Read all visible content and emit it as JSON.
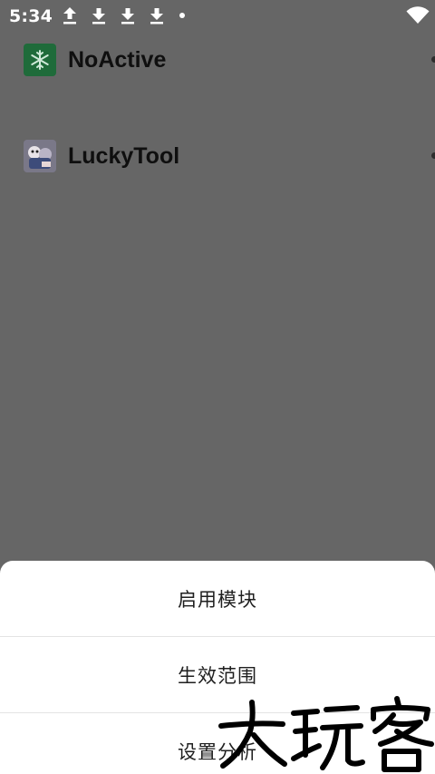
{
  "status_bar": {
    "time": "5:34",
    "icons": [
      "upload-icon",
      "download-icon",
      "download-icon",
      "download-icon",
      "notification-dot",
      "wifi-icon"
    ]
  },
  "app_list": {
    "items": [
      {
        "name": "NoActive",
        "icon": "snowflake-icon",
        "icon_color": "#1f6b3a"
      },
      {
        "name": "LuckyTool",
        "icon": "lucky-tool-icon"
      }
    ]
  },
  "bottom_sheet": {
    "items": [
      {
        "label": "启用模块"
      },
      {
        "label": "生效范围"
      },
      {
        "label": "设置分析"
      }
    ]
  },
  "watermark": {
    "text": "大玩客"
  },
  "colors": {
    "scrim": "#666666",
    "sheet_background": "#ffffff",
    "divider": "#e4e4e4"
  }
}
